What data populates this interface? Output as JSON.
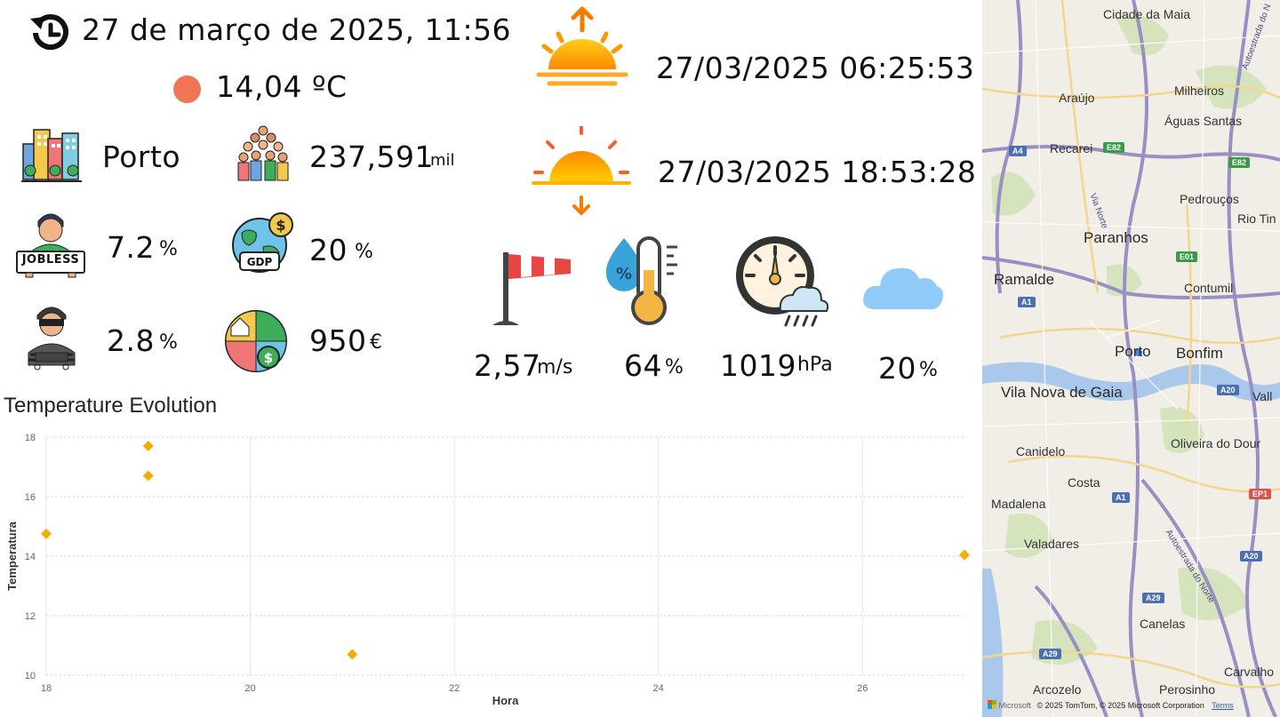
{
  "header": {
    "datetime": "27 de março de 2025, 11:56",
    "temperature": "14,04 ºC",
    "temperature_dot_color": "#f07552",
    "history_icon": "history-clock-icon"
  },
  "city": {
    "name": "Porto",
    "icon": "city-buildings-icon"
  },
  "population": {
    "value": "237,591",
    "unit": "mil",
    "icon": "crowd-icon"
  },
  "unemployment": {
    "value": "7.2",
    "unit": "%",
    "icon": "jobless-person-icon",
    "badge": "JOBLESS"
  },
  "gdp": {
    "value": "20",
    "unit": "%",
    "icon": "globe-gdp-icon",
    "badge": "GDP"
  },
  "crime": {
    "value": "2.8",
    "unit": "%",
    "icon": "thief-icon"
  },
  "cost_of_living": {
    "value": "950",
    "unit": "€",
    "icon": "cost-of-living-icon"
  },
  "sunrise": {
    "value": "27/03/2025 06:25:53",
    "icon": "sunrise-icon"
  },
  "sunset": {
    "value": "27/03/2025 18:53:28",
    "icon": "sunset-icon"
  },
  "weather": {
    "wind": {
      "value": "2,57",
      "unit": "m/s",
      "icon": "windsock-icon"
    },
    "humidity": {
      "value": "64",
      "unit": "%",
      "icon": "humidity-thermometer-icon"
    },
    "pressure": {
      "value": "1019",
      "unit": "hPa",
      "icon": "barometer-icon"
    },
    "clouds": {
      "value": "20",
      "unit": "%",
      "icon": "cloud-icon"
    }
  },
  "chart_data": {
    "type": "scatter",
    "title": "Temperature Evolution",
    "xlabel": "Hora",
    "ylabel": "Temperatura",
    "xlim": [
      18,
      27
    ],
    "ylim": [
      10,
      18
    ],
    "x_ticks": [
      18,
      20,
      22,
      24,
      26
    ],
    "y_ticks": [
      10,
      12,
      14,
      16,
      18
    ],
    "grid": true,
    "marker": "diamond",
    "color": "#f5ad00",
    "points": [
      {
        "x": 18,
        "y": 14.75
      },
      {
        "x": 19,
        "y": 17.7
      },
      {
        "x": 19,
        "y": 16.7
      },
      {
        "x": 21,
        "y": 10.7
      },
      {
        "x": 27,
        "y": 14.04
      }
    ]
  },
  "map": {
    "place_labels": [
      "Cidade da Maia",
      "Araújo",
      "Milheiros",
      "Águas Santas",
      "Recarei",
      "Pedrouços",
      "Rio Tin",
      "Paranhos",
      "Ramalde",
      "Contumil",
      "Porto",
      "Bonfim",
      "Vila Nova de Gaia",
      "Vall",
      "Oliveira do Dour",
      "Canidelo",
      "Costa",
      "Madalena",
      "Valadares",
      "Canelas",
      "Arcozelo",
      "Perosinho",
      "Carvalho"
    ],
    "road_labels": [
      "A4",
      "E82",
      "E82",
      "A1",
      "E01",
      "A20",
      "A1",
      "EP1",
      "A20",
      "A29",
      "A29",
      "Via Norte",
      "Autoestrada do Norte",
      "Autoestrada do N"
    ],
    "attribution": "© 2025 TomTom, © 2025 Microsoft Corporation",
    "terms": "Terms",
    "logo": "Microsoft"
  }
}
